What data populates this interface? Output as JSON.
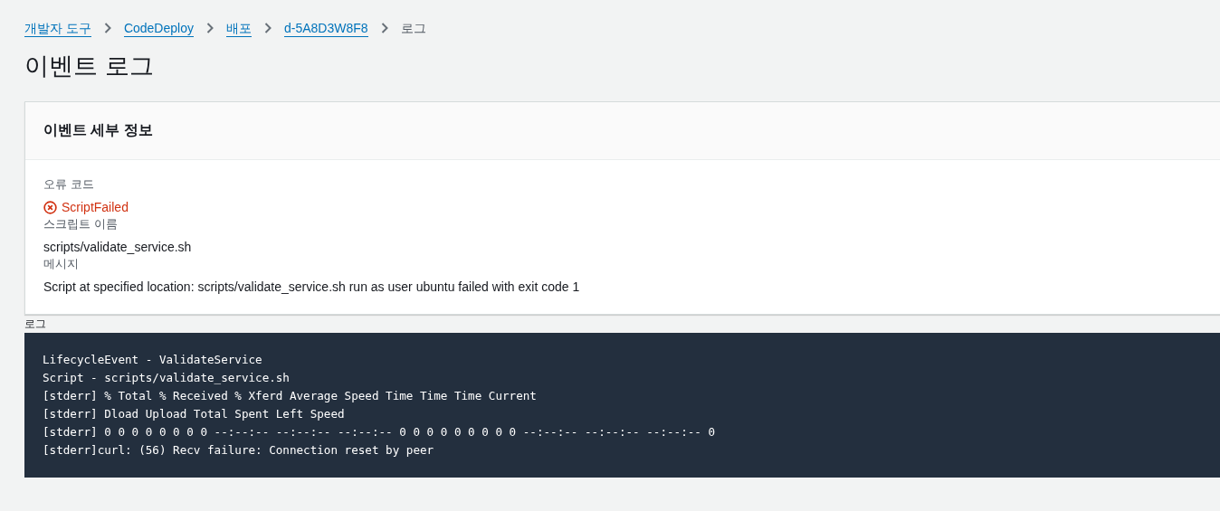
{
  "breadcrumbs": [
    {
      "label": "개발자 도구",
      "kind": "link"
    },
    {
      "label": "CodeDeploy",
      "kind": "link"
    },
    {
      "label": "배포",
      "kind": "link"
    },
    {
      "label": "d-5A8D3W8F8",
      "kind": "link"
    },
    {
      "label": "로그",
      "kind": "current"
    }
  ],
  "page_title": "이벤트 로그",
  "details": {
    "title": "이벤트 세부 정보",
    "fields": [
      {
        "label": "오류 코드",
        "value": "ScriptFailed",
        "kind": "error"
      },
      {
        "label": "스크립트 이름",
        "value": "scripts/validate_service.sh",
        "kind": "text"
      },
      {
        "label": "메시지",
        "value": "Script at specified location: scripts/validate_service.sh run as user ubuntu failed with exit code 1",
        "kind": "text"
      }
    ]
  },
  "log": {
    "label": "로그",
    "lines": [
      "LifecycleEvent - ValidateService",
      "Script - scripts/validate_service.sh",
      "[stderr] % Total % Received % Xferd Average Speed Time Time Time Current",
      "[stderr] Dload Upload Total Spent Left Speed",
      "[stderr] 0 0 0 0 0 0 0 0 --:--:-- --:--:-- --:--:-- 0 0 0 0 0 0 0 0 0 --:--:-- --:--:-- --:--:-- 0",
      "[stderr]curl: (56) Recv failure: Connection reset by peer"
    ]
  }
}
